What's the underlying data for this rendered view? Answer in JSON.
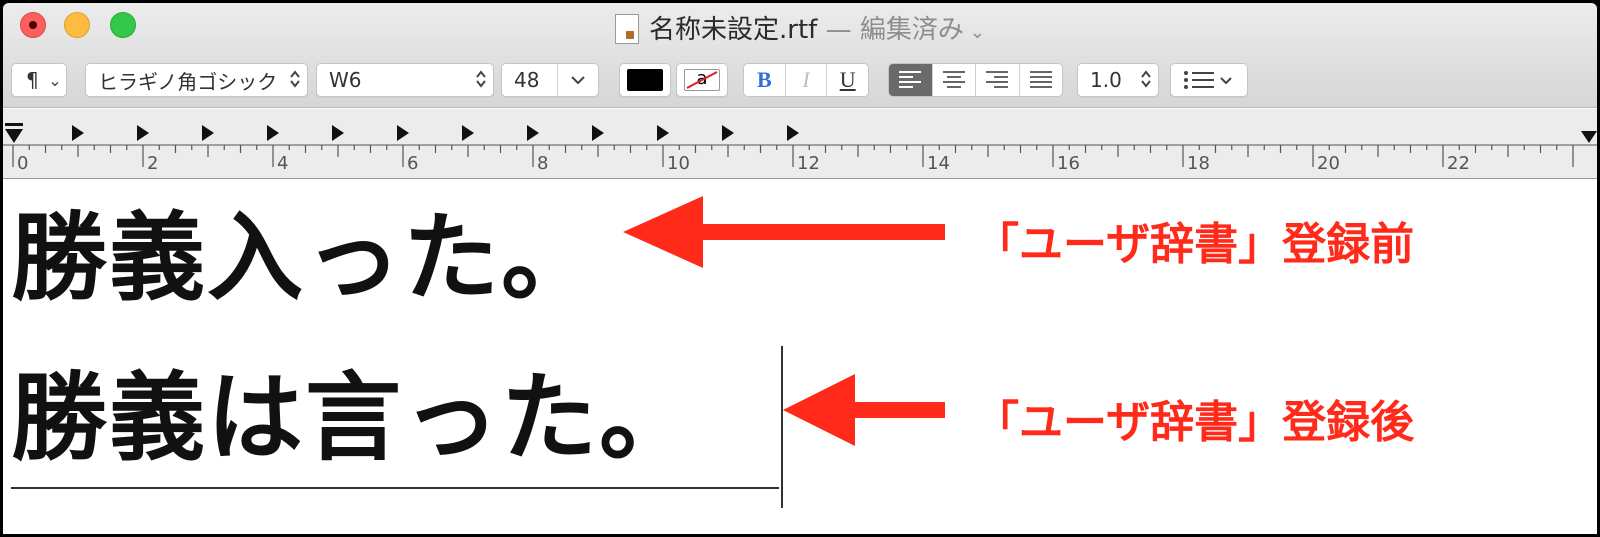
{
  "window": {
    "title": "名称未設定.rtf",
    "title_separator": "—",
    "edited_label": "編集済み",
    "title_chevron": "⌄"
  },
  "toolbar": {
    "paragraph_style": "¶",
    "font_family": "ヒラギノ角ゴシック",
    "font_weight": "W6",
    "font_size": "48",
    "text_color": "#000000",
    "highlight_label": "a",
    "bold_label": "B",
    "italic_label": "I",
    "underline_label": "U",
    "line_spacing": "1.0",
    "updown_glyph": "⌃⌄",
    "dropdown_glyph": "⌄",
    "active_alignment": "left"
  },
  "ruler": {
    "labels": [
      "0",
      "2",
      "4",
      "6",
      "8",
      "10",
      "12",
      "14",
      "16",
      "18",
      "20",
      "22"
    ]
  },
  "document": {
    "line1": "勝義入った。",
    "line2": "勝義は言った。"
  },
  "annotations": {
    "before": "「ユーザ辞書」登録前",
    "after": "「ユーザ辞書」登録後",
    "color": "#ff2a1a"
  }
}
